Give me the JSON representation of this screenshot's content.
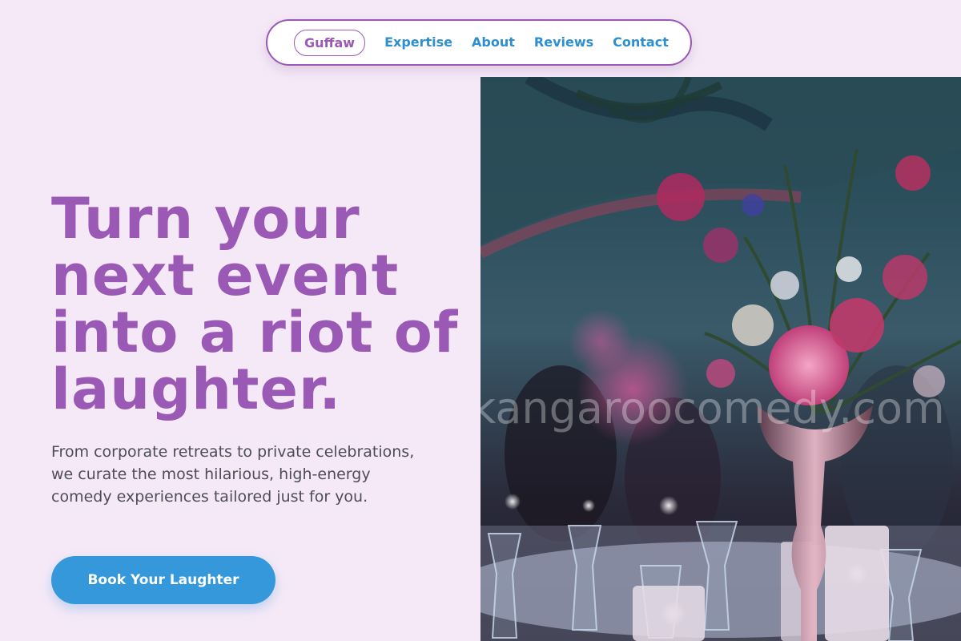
{
  "nav": {
    "brand": "Guffaw",
    "links": [
      "Expertise",
      "About",
      "Reviews",
      "Contact"
    ]
  },
  "hero": {
    "headline": "Turn your next event into a riot of laughter.",
    "subtext": "From corporate retreats to private celebrations, we curate the most hilarious, high-energy comedy experiences tailored just for you.",
    "cta_label": "Book Your Laughter"
  },
  "image": {
    "watermark": "kangaroocomedy.com",
    "description_icon": "event-table-flowers-photo"
  },
  "colors": {
    "brand_purple": "#9b59b6",
    "link_blue": "#2e8fd0",
    "cta_blue": "#3498db",
    "page_background": "#f5e9f7"
  }
}
